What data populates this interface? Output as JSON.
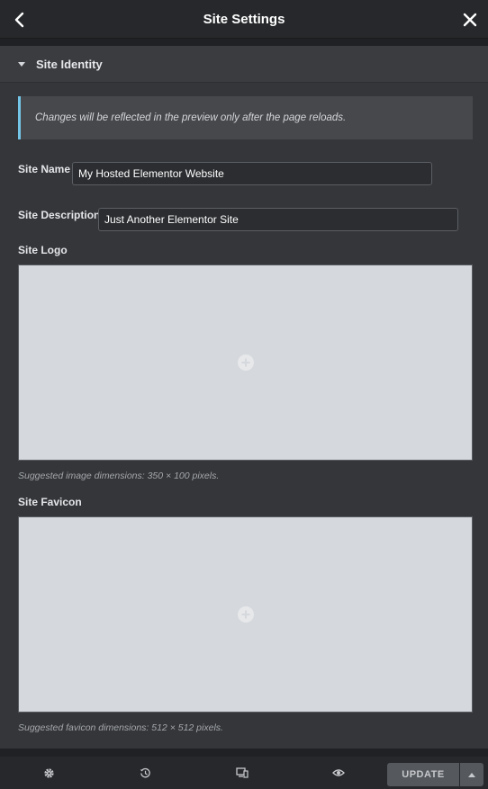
{
  "header": {
    "title": "Site Settings",
    "back_icon": "chevron-left-icon",
    "close_icon": "close-icon"
  },
  "section": {
    "title": "Site Identity",
    "expanded": true
  },
  "notice": {
    "text": "Changes will be reflected in the preview only after the page reloads."
  },
  "fields": {
    "site_name": {
      "label": "Site Name",
      "value": "My Hosted Elementor Website"
    },
    "site_description": {
      "label": "Site Description",
      "value": "Just Another Elementor Site"
    }
  },
  "logo": {
    "label": "Site Logo",
    "hint": "Suggested image dimensions: 350 × 100 pixels."
  },
  "favicon": {
    "label": "Site Favicon",
    "hint": "Suggested favicon dimensions: 512 × 512 pixels."
  },
  "footer": {
    "icons": [
      "settings-icon",
      "history-icon",
      "responsive-icon",
      "preview-icon"
    ],
    "update_label": "UPDATE"
  },
  "colors": {
    "accent": "#74c6e8",
    "panel": "#34363a",
    "media_bg": "#d5d8dc"
  }
}
